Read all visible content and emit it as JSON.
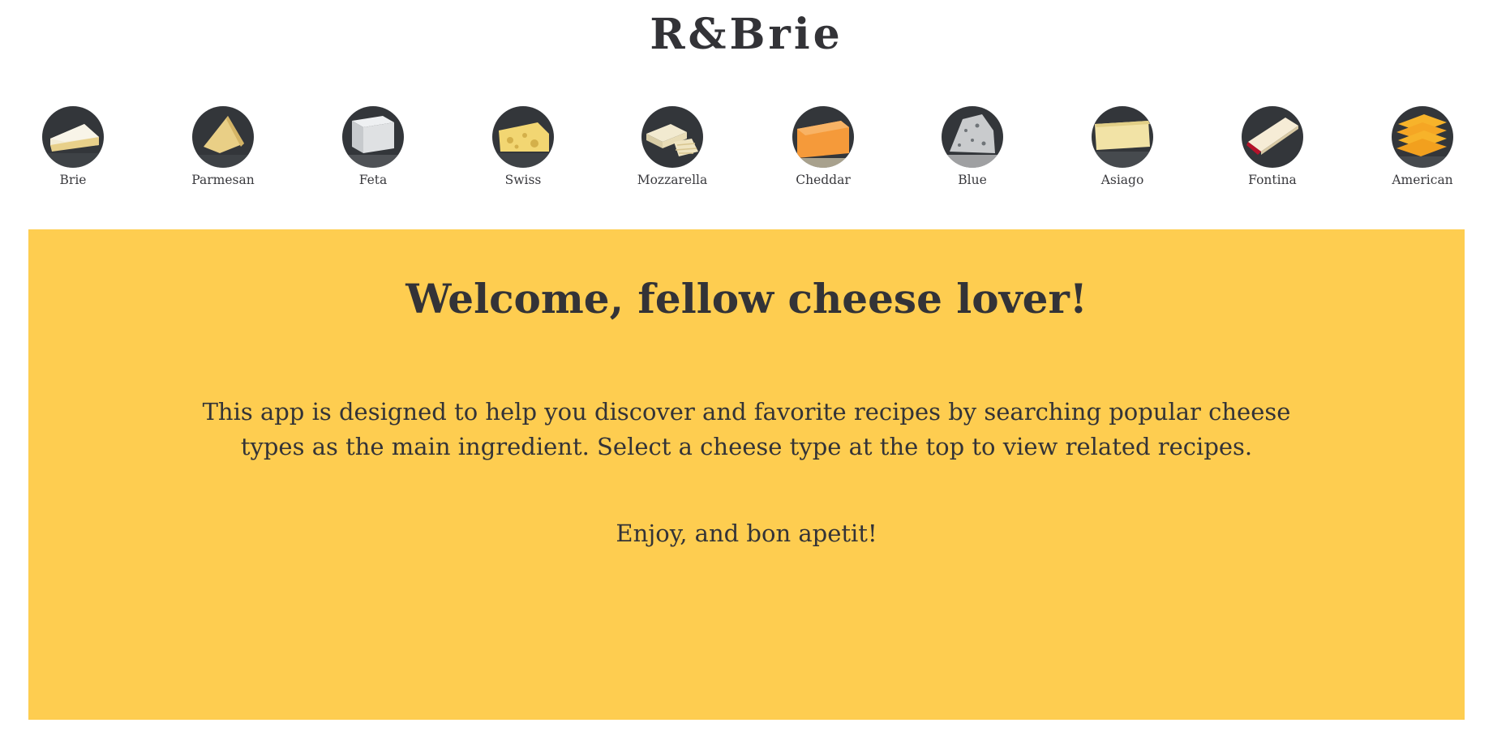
{
  "header": {
    "title": "R&Brie"
  },
  "cheese_nav": {
    "items": [
      {
        "label": "Brie",
        "icon": "brie-wedge-icon",
        "color": "#f3ecd5"
      },
      {
        "label": "Parmesan",
        "icon": "parmesan-wedge-icon",
        "color": "#e9cf86"
      },
      {
        "label": "Feta",
        "icon": "feta-block-icon",
        "color": "#dfe1e3"
      },
      {
        "label": "Swiss",
        "icon": "swiss-wedge-icon",
        "color": "#f2d672"
      },
      {
        "label": "Mozzarella",
        "icon": "mozzarella-shredded-icon",
        "color": "#efe4c0"
      },
      {
        "label": "Cheddar",
        "icon": "cheddar-wedge-icon",
        "color": "#f59a3a"
      },
      {
        "label": "Blue",
        "icon": "blue-cheese-icon",
        "color": "#c9cbcd"
      },
      {
        "label": "Asiago",
        "icon": "asiago-wedge-icon",
        "color": "#f2e3a6"
      },
      {
        "label": "Fontina",
        "icon": "fontina-slice-icon",
        "color": "#f6ecd6"
      },
      {
        "label": "American",
        "icon": "american-slices-icon",
        "color": "#f7b32a"
      }
    ]
  },
  "welcome": {
    "heading": "Welcome, fellow cheese lover!",
    "description": "This app is designed to help you discover and favorite recipes by searching popular cheese types as the main ingredient. Select a cheese type at the top to view related recipes.",
    "signoff": "Enjoy, and bon apetit!",
    "background_color": "#fecd50"
  }
}
